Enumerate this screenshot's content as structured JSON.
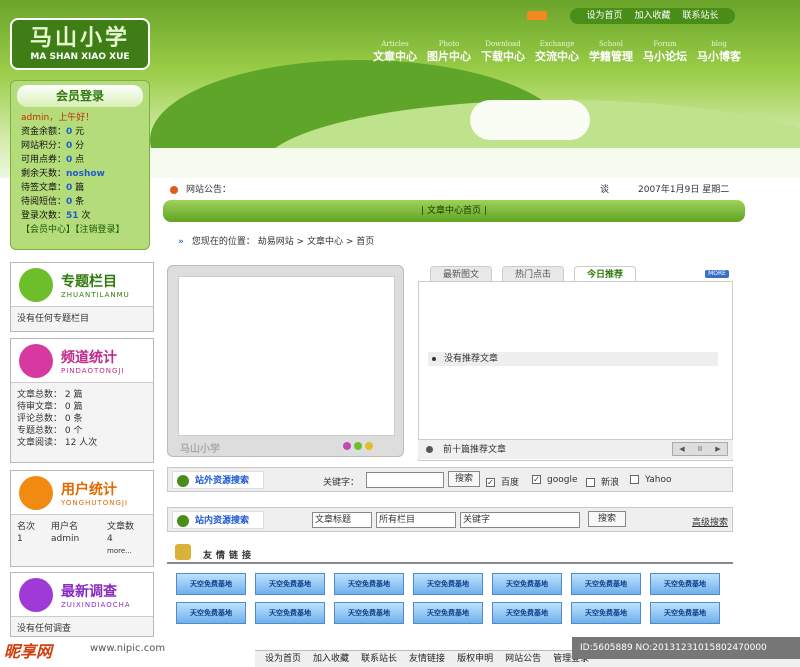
{
  "header": {
    "logo_title": "马山小学",
    "logo_sub": "MA SHAN XIAO XUE",
    "top_links": [
      "设为首页",
      "加入收藏",
      "联系站长"
    ],
    "nav": [
      {
        "en": "Articles",
        "cn": "文章中心"
      },
      {
        "en": "Photo",
        "cn": "图片中心"
      },
      {
        "en": "Download",
        "cn": "下载中心"
      },
      {
        "en": "Exchange",
        "cn": "交流中心"
      },
      {
        "en": "School",
        "cn": "学籍管理"
      },
      {
        "en": "Forum",
        "cn": "马小论坛"
      },
      {
        "en": "blog",
        "cn": "马小博客"
      }
    ]
  },
  "member": {
    "title": "会员登录",
    "greeting": "admin，上午好！",
    "rows": [
      {
        "label": "资金余额：",
        "value": "0",
        "unit": "元"
      },
      {
        "label": "网站积分：",
        "value": "0",
        "unit": "分"
      },
      {
        "label": "可用点券：",
        "value": "0",
        "unit": "点"
      },
      {
        "label": "剩余天数：",
        "value": "noshow",
        "unit": ""
      },
      {
        "label": "待签文章：",
        "value": "0",
        "unit": "篇"
      },
      {
        "label": "待阅短信：",
        "value": "0",
        "unit": "条"
      },
      {
        "label": "登录次数：",
        "value": "51",
        "unit": "次"
      }
    ],
    "links": "【会员中心】【注销登录】"
  },
  "notice": {
    "label": "网站公告：",
    "date_label": "谈",
    "date": "2007年1月9日 星期二"
  },
  "bar_title": "| 文章中心首页 |",
  "crumb": "您现在的位置：  劫易网站 > 文章中心 > 首页",
  "side": {
    "topics": {
      "title": "专题栏目",
      "sub": "ZHUANTILANMU",
      "body": "没有任何专题栏目"
    },
    "stats": {
      "title": "频道统计",
      "sub": "PINDAOTONGJI",
      "rows": [
        "文章总数： 2 篇",
        "待审文章： 0 篇",
        "评论总数： 0 条",
        "专题总数： 0 个",
        "文章阅读： 12 人次"
      ]
    },
    "users": {
      "title": "用户统计",
      "sub": "YONGHUTONGJI",
      "cols": [
        "名次",
        "用户名",
        "文章数"
      ],
      "row": [
        "1",
        "admin",
        "4"
      ],
      "more": "more..."
    },
    "survey": {
      "title": "最新调查",
      "sub": "ZUIXINDIAOCHA",
      "body": "没有任何调查"
    }
  },
  "slides": {
    "watermark": "马山小学"
  },
  "tabs": [
    "最新图文",
    "热门点击",
    "今日推荐"
  ],
  "more_label": "MORE",
  "recommend": "没有推荐文章",
  "top10": "前十篇推荐文章",
  "pager": [
    "◀",
    "II",
    "▶"
  ],
  "search_out": {
    "label": "站外资源搜索",
    "kw": "关键字：",
    "btn": "搜索",
    "engines": [
      {
        "name": "百度",
        "checked": true
      },
      {
        "name": "google",
        "checked": true
      },
      {
        "name": "新浪",
        "checked": false
      },
      {
        "name": "Yahoo",
        "checked": false
      }
    ]
  },
  "search_in": {
    "label": "站内资源搜索",
    "field": "文章标题",
    "column": "所有栏目",
    "kw": "关键字",
    "btn": "搜索",
    "adv": "高级搜索"
  },
  "friends": {
    "title": "友情链接",
    "logo_text": "天空免费基地"
  },
  "footer": [
    "设为首页",
    "加入收藏",
    "联系站长",
    "友情链接",
    "版权申明",
    "网站公告",
    "管理登录"
  ],
  "watermarks": {
    "brand": "昵享网",
    "url": "www.nipic.com",
    "id": "ID:5605889 NO:20131231015802470000"
  },
  "colors": {
    "green": "#5fa322",
    "blue": "#1f5ad0"
  }
}
